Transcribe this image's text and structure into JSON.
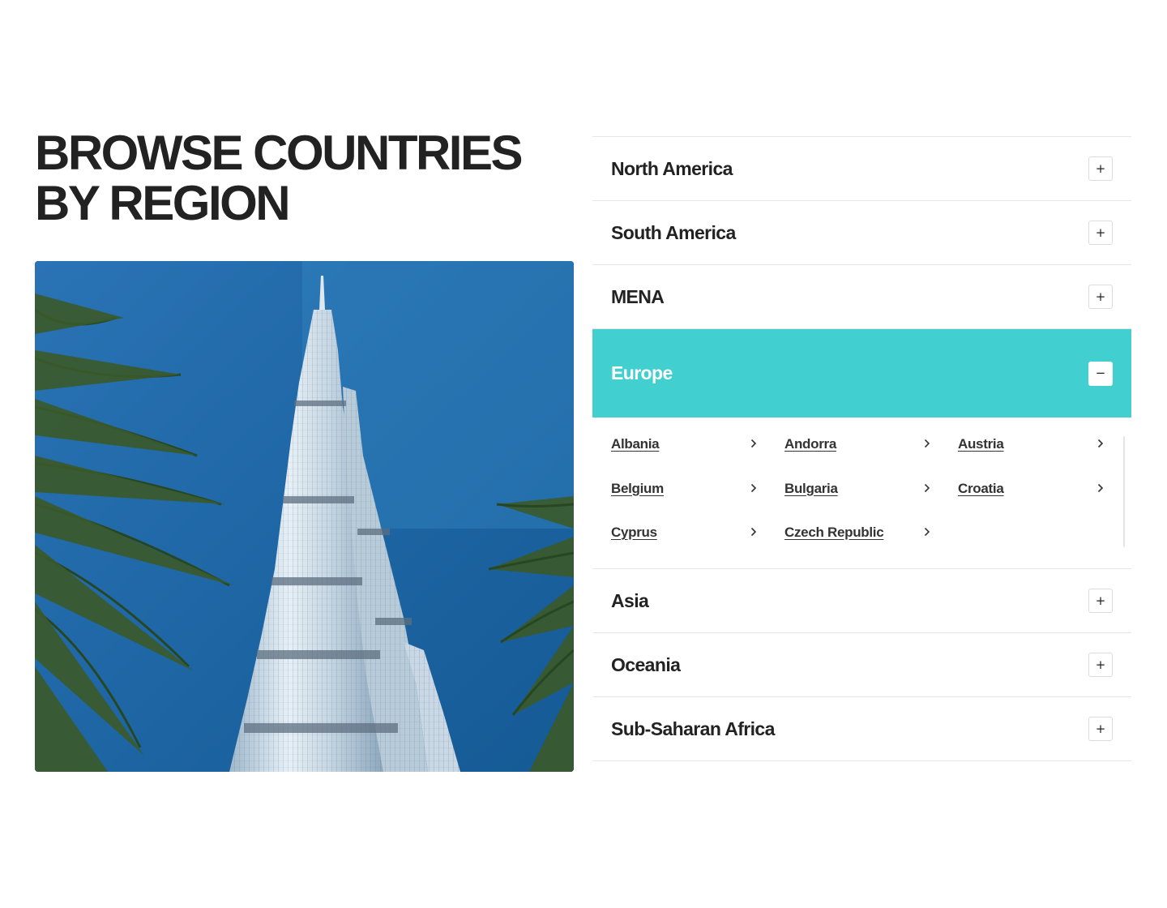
{
  "section": {
    "title_line1": "BROWSE COUNTRIES",
    "title_line2": "BY REGION"
  },
  "image": {
    "description_icon": "burj-khalifa-photo"
  },
  "regions": [
    {
      "label": "North America",
      "state": "collapsed",
      "toggle": "+"
    },
    {
      "label": "South America",
      "state": "collapsed",
      "toggle": "+"
    },
    {
      "label": "MENA",
      "state": "collapsed",
      "toggle": "+"
    },
    {
      "label": "Europe",
      "state": "expanded",
      "toggle": "−"
    },
    {
      "label": "Asia",
      "state": "collapsed",
      "toggle": "+"
    },
    {
      "label": "Oceania",
      "state": "collapsed",
      "toggle": "+"
    },
    {
      "label": "Sub-Saharan Africa",
      "state": "collapsed",
      "toggle": "+"
    }
  ],
  "europe_countries": [
    "Albania",
    "Andorra",
    "Austria",
    "Belgium",
    "Bulgaria",
    "Croatia",
    "Cyprus",
    "Czech Republic"
  ],
  "icons": {
    "expand": "plus-icon",
    "collapse": "minus-icon",
    "country_link": "chevron-right-icon"
  },
  "colors": {
    "accent": "#42cfcf",
    "text": "#222222",
    "divider": "#e6e6e6"
  }
}
